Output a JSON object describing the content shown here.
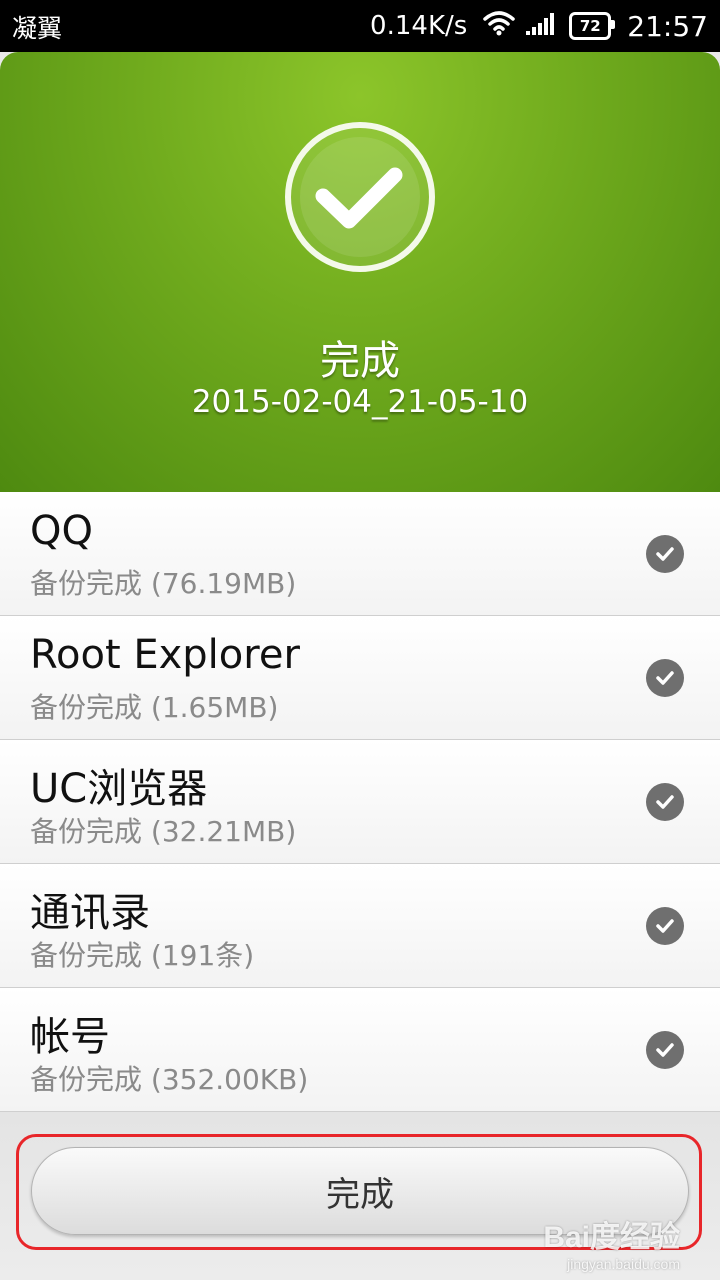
{
  "status_bar": {
    "carrier": "凝翼",
    "speed": "0.14K/s",
    "battery": "72",
    "time": "21:57",
    "icons": [
      "wifi-icon",
      "signal-icon",
      "battery-icon"
    ]
  },
  "hero": {
    "icon": "check-circle-icon",
    "title": "完成",
    "subtitle": "2015-02-04_21-05-10",
    "color": "#6faa1d"
  },
  "items": [
    {
      "name": "QQ",
      "status": "备份完成 (76.19MB)"
    },
    {
      "name": "Root Explorer",
      "status": "备份完成 (1.65MB)"
    },
    {
      "name": "UC浏览器",
      "status": "备份完成 (32.21MB)"
    },
    {
      "name": "通讯录",
      "status": "备份完成 (191条)"
    },
    {
      "name": "帐号",
      "status": "备份完成 (352.00KB)"
    }
  ],
  "footer": {
    "done_button": "完成"
  },
  "watermark": {
    "logo": "Bai度经验",
    "url": "jingyan.baidu.com"
  }
}
